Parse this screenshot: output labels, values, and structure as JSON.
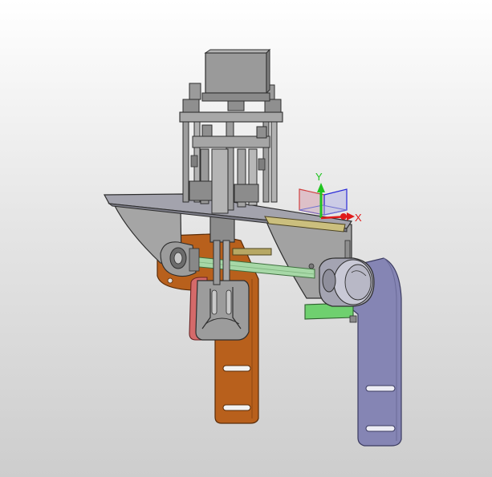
{
  "viewport": {
    "background_top": "#ffffff",
    "background_bottom": "#cdcdcd"
  },
  "triad": {
    "y_label": "Y",
    "x_label": "X",
    "y_color": "#1fc41f",
    "x_color": "#e01b1b",
    "z_color": "#2a2ad8"
  },
  "parts": [
    {
      "name": "stepper-motor",
      "color": "#9a9a9a"
    },
    {
      "name": "top-plate",
      "color": "#a3a3ad"
    },
    {
      "name": "side-gusset-left",
      "color": "#a0a0a0"
    },
    {
      "name": "side-gusset-right",
      "color": "#a0a0a0"
    },
    {
      "name": "orange-bracket",
      "color": "#b8601c"
    },
    {
      "name": "blue-arm",
      "color": "#8585b4"
    },
    {
      "name": "red-clip",
      "color": "#d56a6a"
    },
    {
      "name": "green-shaft",
      "color": "#a7d8a7"
    },
    {
      "name": "green-base",
      "color": "#6fd06f"
    },
    {
      "name": "bearing-housing",
      "color": "#a4a4b2"
    }
  ]
}
